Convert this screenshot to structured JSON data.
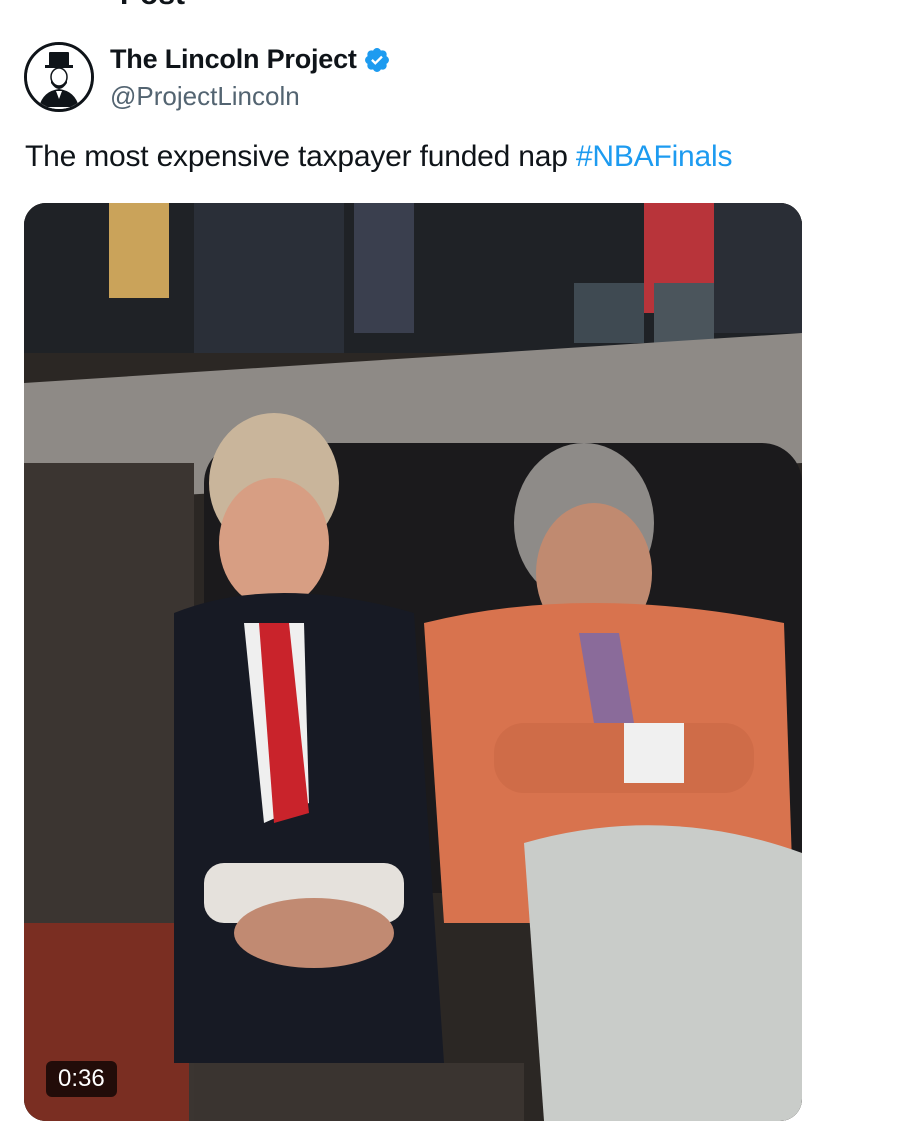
{
  "header": {
    "title_partial": "Post"
  },
  "author": {
    "display_name": "The Lincoln Project",
    "handle": "@ProjectLincoln",
    "verified_icon": "verified-badge-icon",
    "avatar_icon": "lincoln-portrait-icon"
  },
  "tweet": {
    "text": "The most expensive taxpayer funded nap ",
    "hashtag": "#NBAFinals"
  },
  "video": {
    "duration": "0:36"
  },
  "colors": {
    "link": "#1d9bf0",
    "verified": "#1d9bf0",
    "secondary_text": "#536471"
  }
}
